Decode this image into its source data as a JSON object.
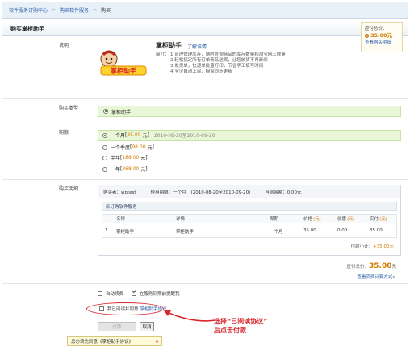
{
  "breadcrumb": {
    "items": [
      "软件服务订购中心",
      "购买软件服务",
      "购买"
    ]
  },
  "section_title": "购买掌柜助手",
  "description": {
    "label": "说明",
    "logo_text": "掌柜助手",
    "product_name": "掌柜助手",
    "details_link": "了解详情",
    "intro_lead": "简介：",
    "intro_lines": [
      "1.合理管理库存，随时查询商品的库存数量和淘宝网上数量",
      "2.轻松搞定所有订单商品送货，让您放货不再麻烦",
      "3.发货单，快递单批量打印，节省手工填写时间",
      "4.宝贝自动上架，橱窗同步更新"
    ]
  },
  "purchase_type": {
    "label": "购买类型",
    "selected": "掌柜助手"
  },
  "period": {
    "label": "期限",
    "options": [
      {
        "text": "一个月",
        "price": "35.00",
        "unit": "元",
        "range": "2010-08-20至2010-09-20",
        "selected": true
      },
      {
        "text": "一个季度",
        "price": "98.00",
        "unit": "元",
        "range": "",
        "selected": false
      },
      {
        "text": "半年",
        "price": "188.00",
        "unit": "元",
        "range": "",
        "selected": false
      },
      {
        "text": "一年",
        "price": "368.00",
        "unit": "元",
        "range": "",
        "selected": false
      }
    ]
  },
  "detail": {
    "label": "购买明细",
    "buyer": "购买者：wptest",
    "usage_period": "使用期限：一个月",
    "usage_range": "(2010-08-20至2010-09-20)",
    "balance": "当前余额：0.00元",
    "order_head": "新订购软件服务",
    "columns": [
      {
        "label": "名称",
        "unit": ""
      },
      {
        "label": "详情",
        "unit": ""
      },
      {
        "label": "周期",
        "unit": ""
      },
      {
        "label": "价格",
        "unit": "(元)"
      },
      {
        "label": "优惠",
        "unit": "(元)"
      },
      {
        "label": "实付",
        "unit": "(元)"
      }
    ],
    "row": {
      "index": "1",
      "name": "掌柜助手",
      "detail": "掌柜助手",
      "cycle": "一个月",
      "price": "35.00",
      "discount": "0.00",
      "paid": "35.00"
    },
    "subtotal_label": "付款小计：",
    "subtotal_value": "+35.00元"
  },
  "total": {
    "label": "应付总价：",
    "amount": "35.00",
    "unit": "元",
    "tax_link": "查看资费计算方式>"
  },
  "options": {
    "auto_renew": "自动续费",
    "remind": "在服务到期前提醒我",
    "agree_prefix": "我已阅读并同意",
    "agree_link": "掌柜助手协议"
  },
  "buttons": {
    "pay": "付款",
    "cancel": "取消"
  },
  "tooltip": "您必须先同意《掌柜助手协议》",
  "annotation": {
    "line1": "选择“已阅读协议”",
    "line2": "后点击付款"
  },
  "side_box": {
    "label": "应付总价：",
    "amount": "35.00元",
    "link": "查看购买明细"
  },
  "colors": {
    "accent_orange": "#d27a00",
    "link_blue": "#2a5da8",
    "annotation_red": "#d8262b"
  }
}
